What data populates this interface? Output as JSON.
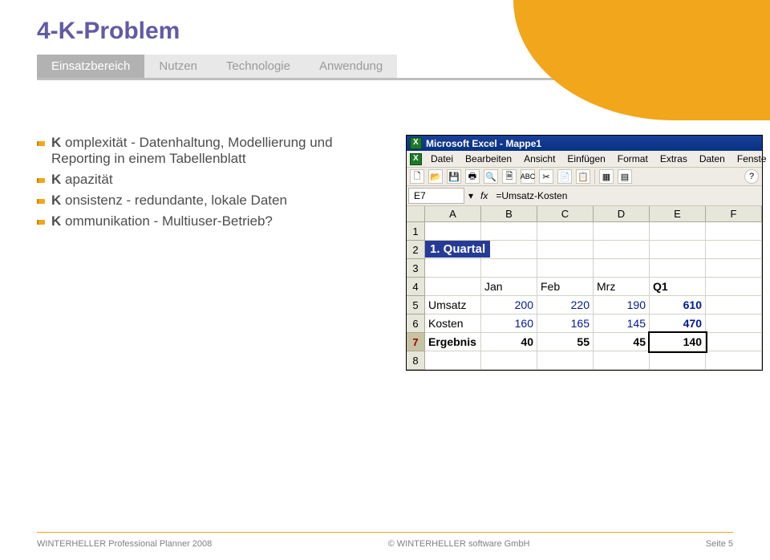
{
  "header": {
    "title": "4-K-Problem",
    "tabs": [
      "Einsatzbereich",
      "Nutzen",
      "Technologie",
      "Anwendung"
    ]
  },
  "bullets": [
    {
      "k": "K",
      "rest": " omplexität - Datenhaltung, Modellierung und Reporting in einem Tabellenblatt"
    },
    {
      "k": "K",
      "rest": " apazität"
    },
    {
      "k": "K",
      "rest": " onsistenz - redundante, lokale Daten"
    },
    {
      "k": "K",
      "rest": " ommunikation - Multiuser-Betrieb?"
    }
  ],
  "excel": {
    "app_title": "Microsoft Excel - Mappe1",
    "menus": [
      "Datei",
      "Bearbeiten",
      "Ansicht",
      "Einfügen",
      "Format",
      "Extras",
      "Daten",
      "Fenste"
    ],
    "selected_cell": "E7",
    "formula": "=Umsatz-Kosten",
    "columns": [
      "A",
      "B",
      "C",
      "D",
      "E",
      "F"
    ],
    "quarter_title": "1. Quartal",
    "row4": [
      "",
      "Jan",
      "Feb",
      "Mrz",
      "Q1",
      ""
    ],
    "row5": [
      "Umsatz",
      "200",
      "220",
      "190",
      "610",
      ""
    ],
    "row6": [
      "Kosten",
      "160",
      "165",
      "145",
      "470",
      ""
    ],
    "row7": [
      "Ergebnis",
      "40",
      "55",
      "45",
      "140",
      ""
    ]
  },
  "footer": {
    "left": "WINTERHELLER Professional Planner 2008",
    "center": "© WINTERHELLER software GmbH",
    "right": "Seite 5"
  }
}
